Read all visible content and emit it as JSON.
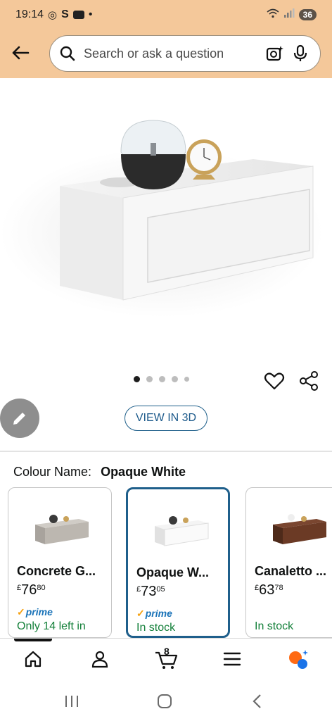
{
  "status": {
    "time": "19:14",
    "app_icons": [
      "whatsapp-icon",
      "s-icon",
      "youtube-icon"
    ],
    "dot": "•",
    "battery": "36"
  },
  "search": {
    "placeholder": "Search or ask a question"
  },
  "gallery": {
    "image_count": 5,
    "active_index": 0
  },
  "actions": {
    "view_3d_label": "VIEW IN 3D"
  },
  "colour": {
    "label": "Colour Name:",
    "selected": "Opaque White"
  },
  "variants": [
    {
      "name": "Concrete G...",
      "price_main": "76",
      "price_fraction": "80",
      "currency": "£",
      "prime": "prime",
      "stock": "Only 14 left in",
      "selected": false,
      "color": "#b5b0aa"
    },
    {
      "name": "Opaque W...",
      "price_main": "73",
      "price_fraction": "05",
      "currency": "£",
      "prime": "prime",
      "stock": "In stock",
      "selected": true,
      "color": "#f2f2f2"
    },
    {
      "name": "Canaletto ...",
      "price_main": "63",
      "price_fraction": "78",
      "currency": "£",
      "prime": "",
      "stock": "In stock",
      "selected": false,
      "color": "#6b3a25"
    }
  ],
  "tabbar": {
    "cart_count": "8",
    "tabs": [
      "home-icon",
      "account-icon",
      "cart-icon",
      "menu-icon",
      "rufus-ai-icon"
    ]
  },
  "colors": {
    "header_bg": "#f4c89a",
    "link_blue": "#1c5a8b",
    "in_stock_green": "#14803a",
    "prime_blue": "#1a73b8"
  }
}
